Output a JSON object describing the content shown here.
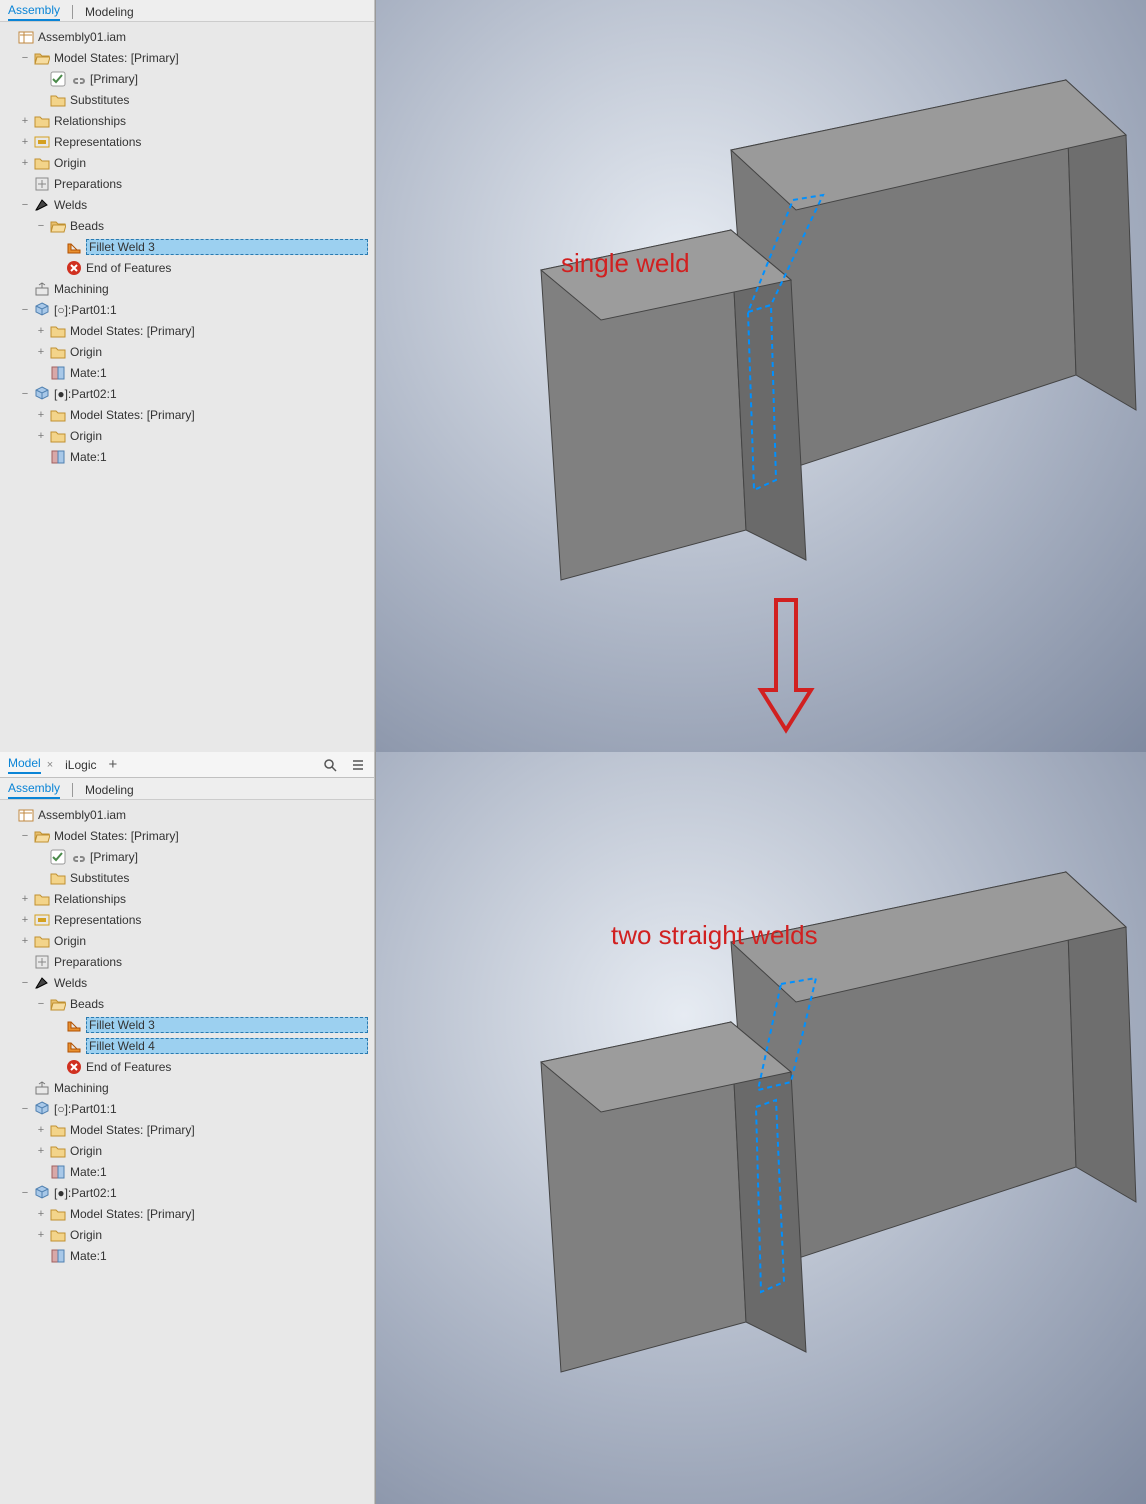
{
  "top": {
    "subtabs": {
      "assembly": "Assembly",
      "modeling": "Modeling"
    },
    "annotation": "single weld",
    "tree": {
      "root": "Assembly01.iam",
      "modelStates": "Model States: [Primary]",
      "primary": "[Primary]",
      "substitutes": "Substitutes",
      "relationships": "Relationships",
      "representations": "Representations",
      "origin": "Origin",
      "preparations": "Preparations",
      "welds": "Welds",
      "beads": "Beads",
      "fillet3": "Fillet Weld 3",
      "eof": "End of Features",
      "machining": "Machining",
      "part01": "[○]:Part01:1",
      "p1ms": "Model States: [Primary]",
      "p1origin": "Origin",
      "p1mate": "Mate:1",
      "part02": "[●]:Part02:1",
      "p2ms": "Model States: [Primary]",
      "p2origin": "Origin",
      "p2mate": "Mate:1"
    }
  },
  "bot": {
    "header": {
      "model": "Model",
      "ilogic": "iLogic"
    },
    "subtabs": {
      "assembly": "Assembly",
      "modeling": "Modeling"
    },
    "annotation": "two straight welds",
    "tree": {
      "root": "Assembly01.iam",
      "modelStates": "Model States: [Primary]",
      "primary": "[Primary]",
      "substitutes": "Substitutes",
      "relationships": "Relationships",
      "representations": "Representations",
      "origin": "Origin",
      "preparations": "Preparations",
      "welds": "Welds",
      "beads": "Beads",
      "fillet3": "Fillet Weld 3",
      "fillet4": "Fillet Weld 4",
      "eof": "End of Features",
      "machining": "Machining",
      "part01": "[○]:Part01:1",
      "p1ms": "Model States: [Primary]",
      "p1origin": "Origin",
      "p1mate": "Mate:1",
      "part02": "[●]:Part02:1",
      "p2ms": "Model States: [Primary]",
      "p2origin": "Origin",
      "p2mate": "Mate:1"
    }
  }
}
